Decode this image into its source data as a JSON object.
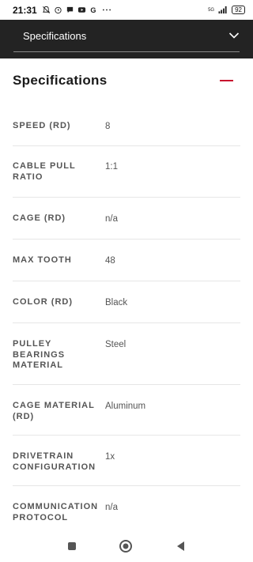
{
  "status_bar": {
    "time": "21:31",
    "network": "5G",
    "battery": "92"
  },
  "header": {
    "dropdown_label": "Specifications"
  },
  "section": {
    "title": "Specifications"
  },
  "specs": [
    {
      "label": "SPEED (RD)",
      "value": "8"
    },
    {
      "label": "CABLE PULL RATIO",
      "value": "1:1"
    },
    {
      "label": "CAGE (RD)",
      "value": "n/a"
    },
    {
      "label": "MAX TOOTH",
      "value": "48"
    },
    {
      "label": "COLOR (RD)",
      "value": "Black"
    },
    {
      "label": "PULLEY BEARINGS MATERIAL",
      "value": "Steel"
    },
    {
      "label": "CAGE MATERIAL (RD)",
      "value": "Aluminum"
    },
    {
      "label": "DRIVETRAIN CONFIGURATION",
      "value": "1x"
    },
    {
      "label": "COMMUNICATION PROTOCOL",
      "value": "n/a"
    }
  ],
  "colors": {
    "header_bg": "#232323",
    "accent": "#c8102e"
  }
}
